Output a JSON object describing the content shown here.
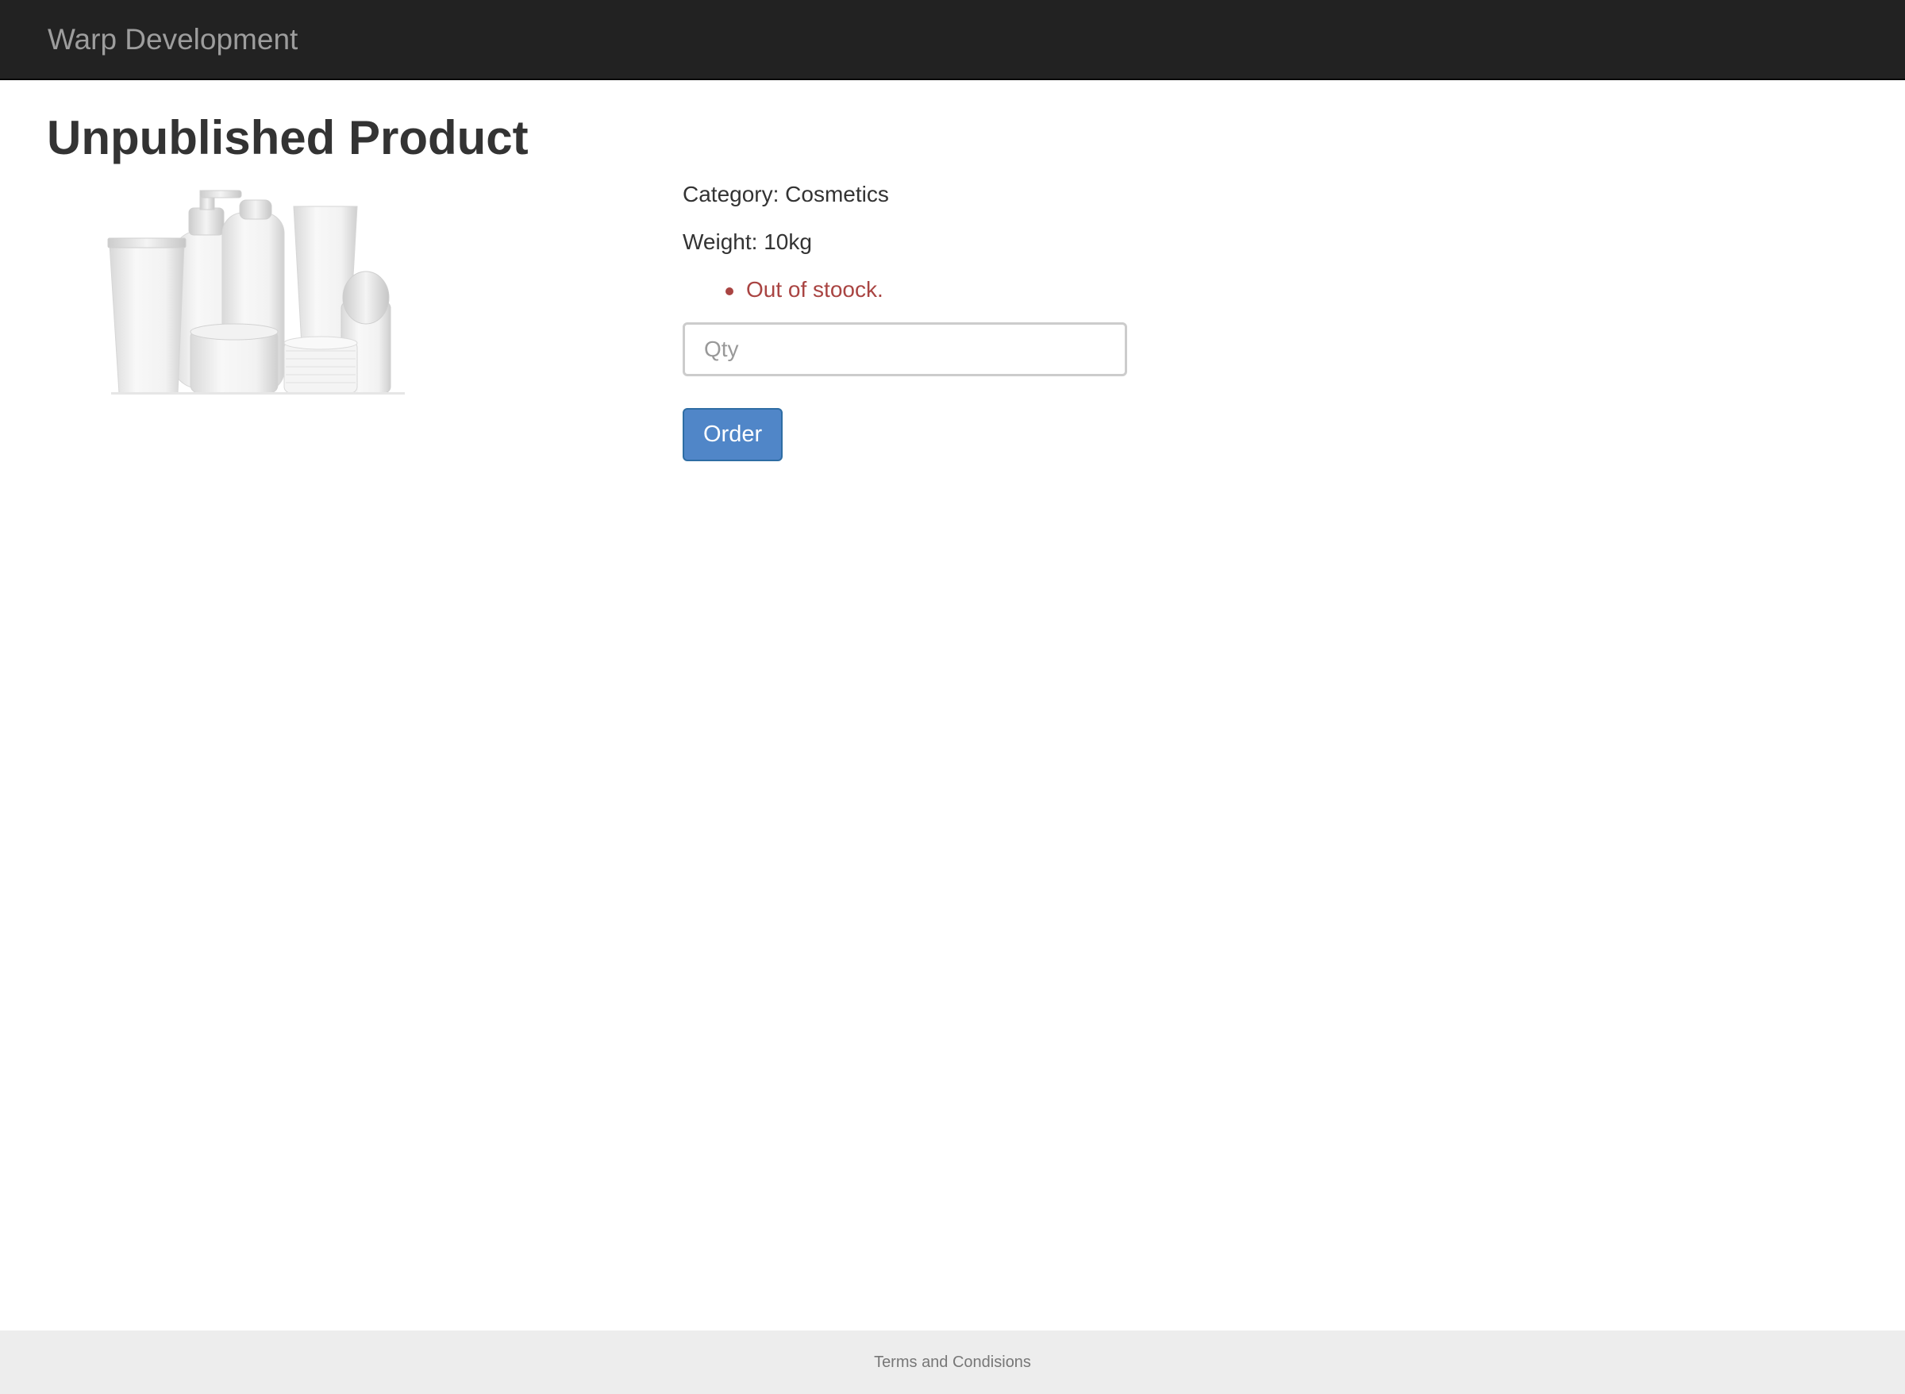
{
  "navbar": {
    "brand": "Warp Development"
  },
  "product": {
    "title": "Unpublished Product",
    "image_alt": "cosmetics-product-image",
    "category_line": "Category: Cosmetics",
    "weight_line": "Weight: 10kg",
    "stock_messages": [
      "Out of stoock."
    ]
  },
  "order_form": {
    "qty_placeholder": "Qty",
    "qty_value": "",
    "order_label": "Order"
  },
  "footer": {
    "terms_link": "Terms and Condisions"
  },
  "colors": {
    "navbar_bg": "#222222",
    "brand_text": "#9d9d9d",
    "error_text": "#a94442",
    "button_primary": "#5086c8",
    "footer_bg": "#ededed"
  }
}
